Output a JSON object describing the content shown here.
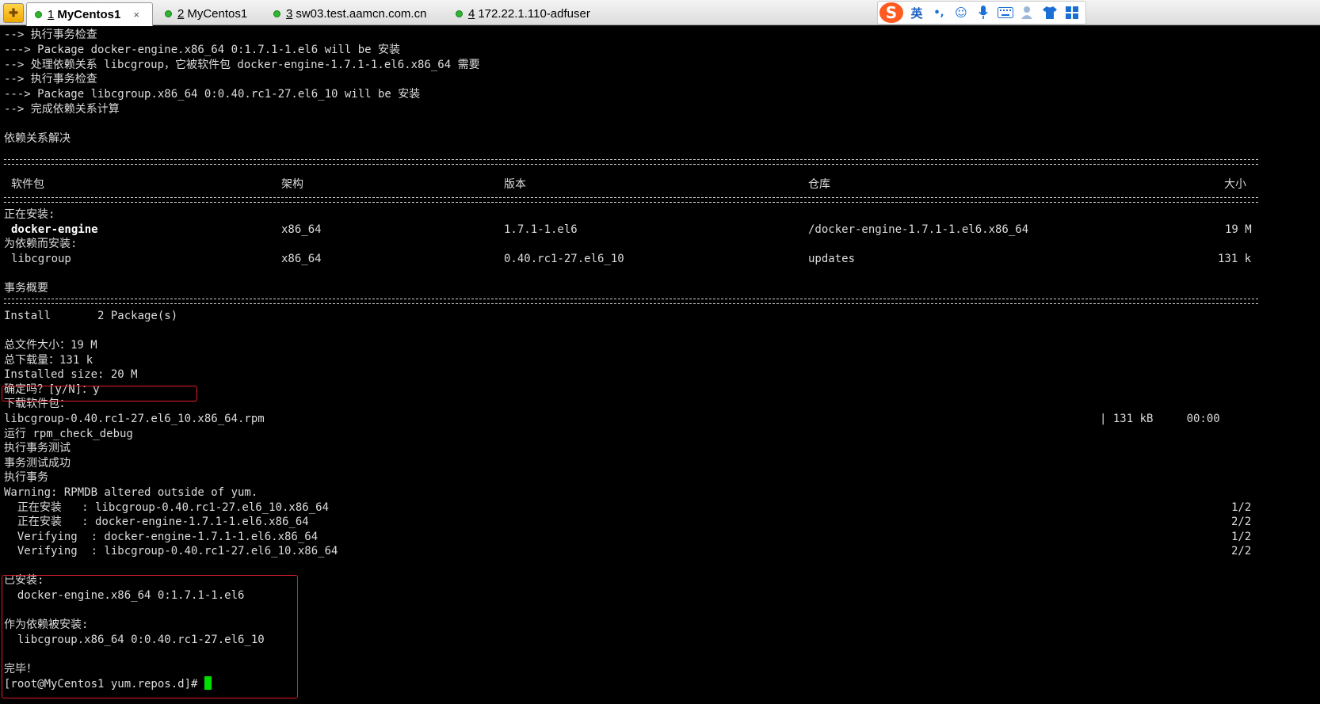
{
  "tabs": [
    {
      "num": "1",
      "title": "MyCentos1",
      "active": true,
      "close": "×"
    },
    {
      "num": "2",
      "title": "MyCentos1"
    },
    {
      "num": "3",
      "title": "sw03.test.aamcn.com.cn"
    },
    {
      "num": "4",
      "title": "172.22.1.110-adfuser"
    }
  ],
  "ime": {
    "logo": "S",
    "lang": "英",
    "punct": "•,",
    "icons": [
      "emoji-icon",
      "microphone-icon",
      "keyboard-icon",
      "user-icon",
      "shirt-icon",
      "grid-icon"
    ]
  },
  "terminal": {
    "pre_lines": [
      "--> 执行事务检查",
      "---> Package docker-engine.x86_64 0:1.7.1-1.el6 will be 安装",
      "--> 处理依赖关系 libcgroup，它被软件包 docker-engine-1.7.1-1.el6.x86_64 需要",
      "--> 执行事务检查",
      "---> Package libcgroup.x86_64 0:0.40.rc1-27.el6_10 will be 安装",
      "--> 完成依赖关系计算",
      "",
      "依赖关系解决"
    ],
    "table": {
      "headers": [
        "软件包",
        "架构",
        "版本",
        "仓库",
        "大小"
      ],
      "installing_label": "正在安装:",
      "dep_label": "为依赖而安装:",
      "rows": [
        {
          "pkg": "docker-engine",
          "arch": "x86_64",
          "ver": "1.7.1-1.el6",
          "repo": "/docker-engine-1.7.1-1.el6.x86_64",
          "size": "19 M"
        },
        {
          "pkg": "libcgroup",
          "arch": "x86_64",
          "ver": "0.40.rc1-27.el6_10",
          "repo": "updates",
          "size": "131 k"
        }
      ],
      "summary_label": "事务概要",
      "install_line": "Install       2 Package(s)"
    },
    "totals": [
      "总文件大小：19 M",
      "总下载量：131 k",
      "Installed size: 20 M"
    ],
    "confirm": "确定吗？[y/N]：y",
    "download_label": "下载软件包：",
    "download_file": "libcgroup-0.40.rc1-27.el6_10.x86_64.rpm",
    "download_size": "| 131 kB     00:00",
    "post_lines": [
      "运行 rpm_check_debug",
      "执行事务测试",
      "事务测试成功",
      "执行事务",
      "Warning: RPMDB altered outside of yum."
    ],
    "progress": [
      {
        "text": "  正在安装   : libcgroup-0.40.rc1-27.el6_10.x86_64",
        "count": "1/2"
      },
      {
        "text": "  正在安装   : docker-engine-1.7.1-1.el6.x86_64",
        "count": "2/2"
      },
      {
        "text": "  Verifying  : docker-engine-1.7.1-1.el6.x86_64",
        "count": "1/2"
      },
      {
        "text": "  Verifying  : libcgroup-0.40.rc1-27.el6_10.x86_64",
        "count": "2/2"
      }
    ],
    "result": [
      "已安装:",
      "  docker-engine.x86_64 0:1.7.1-1.el6",
      "",
      "作为依赖被安装:",
      "  libcgroup.x86_64 0:0.40.rc1-27.el6_10",
      "",
      "完毕！"
    ],
    "prompt": "[root@MyCentos1 yum.repos.d]# "
  }
}
